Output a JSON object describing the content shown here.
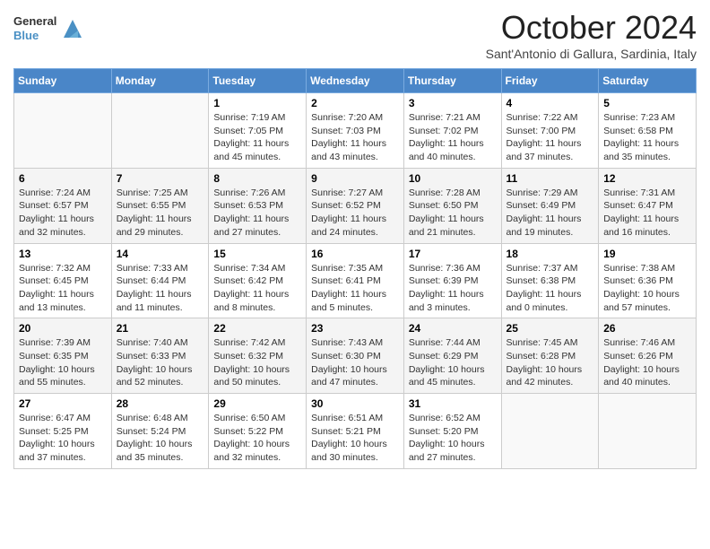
{
  "header": {
    "logo": {
      "general": "General",
      "blue": "Blue"
    },
    "title": "October 2024",
    "location": "Sant'Antonio di Gallura, Sardinia, Italy"
  },
  "weekdays": [
    "Sunday",
    "Monday",
    "Tuesday",
    "Wednesday",
    "Thursday",
    "Friday",
    "Saturday"
  ],
  "weeks": [
    [
      {
        "day": "",
        "info": ""
      },
      {
        "day": "",
        "info": ""
      },
      {
        "day": "1",
        "info": "Sunrise: 7:19 AM\nSunset: 7:05 PM\nDaylight: 11 hours and 45 minutes."
      },
      {
        "day": "2",
        "info": "Sunrise: 7:20 AM\nSunset: 7:03 PM\nDaylight: 11 hours and 43 minutes."
      },
      {
        "day": "3",
        "info": "Sunrise: 7:21 AM\nSunset: 7:02 PM\nDaylight: 11 hours and 40 minutes."
      },
      {
        "day": "4",
        "info": "Sunrise: 7:22 AM\nSunset: 7:00 PM\nDaylight: 11 hours and 37 minutes."
      },
      {
        "day": "5",
        "info": "Sunrise: 7:23 AM\nSunset: 6:58 PM\nDaylight: 11 hours and 35 minutes."
      }
    ],
    [
      {
        "day": "6",
        "info": "Sunrise: 7:24 AM\nSunset: 6:57 PM\nDaylight: 11 hours and 32 minutes."
      },
      {
        "day": "7",
        "info": "Sunrise: 7:25 AM\nSunset: 6:55 PM\nDaylight: 11 hours and 29 minutes."
      },
      {
        "day": "8",
        "info": "Sunrise: 7:26 AM\nSunset: 6:53 PM\nDaylight: 11 hours and 27 minutes."
      },
      {
        "day": "9",
        "info": "Sunrise: 7:27 AM\nSunset: 6:52 PM\nDaylight: 11 hours and 24 minutes."
      },
      {
        "day": "10",
        "info": "Sunrise: 7:28 AM\nSunset: 6:50 PM\nDaylight: 11 hours and 21 minutes."
      },
      {
        "day": "11",
        "info": "Sunrise: 7:29 AM\nSunset: 6:49 PM\nDaylight: 11 hours and 19 minutes."
      },
      {
        "day": "12",
        "info": "Sunrise: 7:31 AM\nSunset: 6:47 PM\nDaylight: 11 hours and 16 minutes."
      }
    ],
    [
      {
        "day": "13",
        "info": "Sunrise: 7:32 AM\nSunset: 6:45 PM\nDaylight: 11 hours and 13 minutes."
      },
      {
        "day": "14",
        "info": "Sunrise: 7:33 AM\nSunset: 6:44 PM\nDaylight: 11 hours and 11 minutes."
      },
      {
        "day": "15",
        "info": "Sunrise: 7:34 AM\nSunset: 6:42 PM\nDaylight: 11 hours and 8 minutes."
      },
      {
        "day": "16",
        "info": "Sunrise: 7:35 AM\nSunset: 6:41 PM\nDaylight: 11 hours and 5 minutes."
      },
      {
        "day": "17",
        "info": "Sunrise: 7:36 AM\nSunset: 6:39 PM\nDaylight: 11 hours and 3 minutes."
      },
      {
        "day": "18",
        "info": "Sunrise: 7:37 AM\nSunset: 6:38 PM\nDaylight: 11 hours and 0 minutes."
      },
      {
        "day": "19",
        "info": "Sunrise: 7:38 AM\nSunset: 6:36 PM\nDaylight: 10 hours and 57 minutes."
      }
    ],
    [
      {
        "day": "20",
        "info": "Sunrise: 7:39 AM\nSunset: 6:35 PM\nDaylight: 10 hours and 55 minutes."
      },
      {
        "day": "21",
        "info": "Sunrise: 7:40 AM\nSunset: 6:33 PM\nDaylight: 10 hours and 52 minutes."
      },
      {
        "day": "22",
        "info": "Sunrise: 7:42 AM\nSunset: 6:32 PM\nDaylight: 10 hours and 50 minutes."
      },
      {
        "day": "23",
        "info": "Sunrise: 7:43 AM\nSunset: 6:30 PM\nDaylight: 10 hours and 47 minutes."
      },
      {
        "day": "24",
        "info": "Sunrise: 7:44 AM\nSunset: 6:29 PM\nDaylight: 10 hours and 45 minutes."
      },
      {
        "day": "25",
        "info": "Sunrise: 7:45 AM\nSunset: 6:28 PM\nDaylight: 10 hours and 42 minutes."
      },
      {
        "day": "26",
        "info": "Sunrise: 7:46 AM\nSunset: 6:26 PM\nDaylight: 10 hours and 40 minutes."
      }
    ],
    [
      {
        "day": "27",
        "info": "Sunrise: 6:47 AM\nSunset: 5:25 PM\nDaylight: 10 hours and 37 minutes."
      },
      {
        "day": "28",
        "info": "Sunrise: 6:48 AM\nSunset: 5:24 PM\nDaylight: 10 hours and 35 minutes."
      },
      {
        "day": "29",
        "info": "Sunrise: 6:50 AM\nSunset: 5:22 PM\nDaylight: 10 hours and 32 minutes."
      },
      {
        "day": "30",
        "info": "Sunrise: 6:51 AM\nSunset: 5:21 PM\nDaylight: 10 hours and 30 minutes."
      },
      {
        "day": "31",
        "info": "Sunrise: 6:52 AM\nSunset: 5:20 PM\nDaylight: 10 hours and 27 minutes."
      },
      {
        "day": "",
        "info": ""
      },
      {
        "day": "",
        "info": ""
      }
    ]
  ]
}
